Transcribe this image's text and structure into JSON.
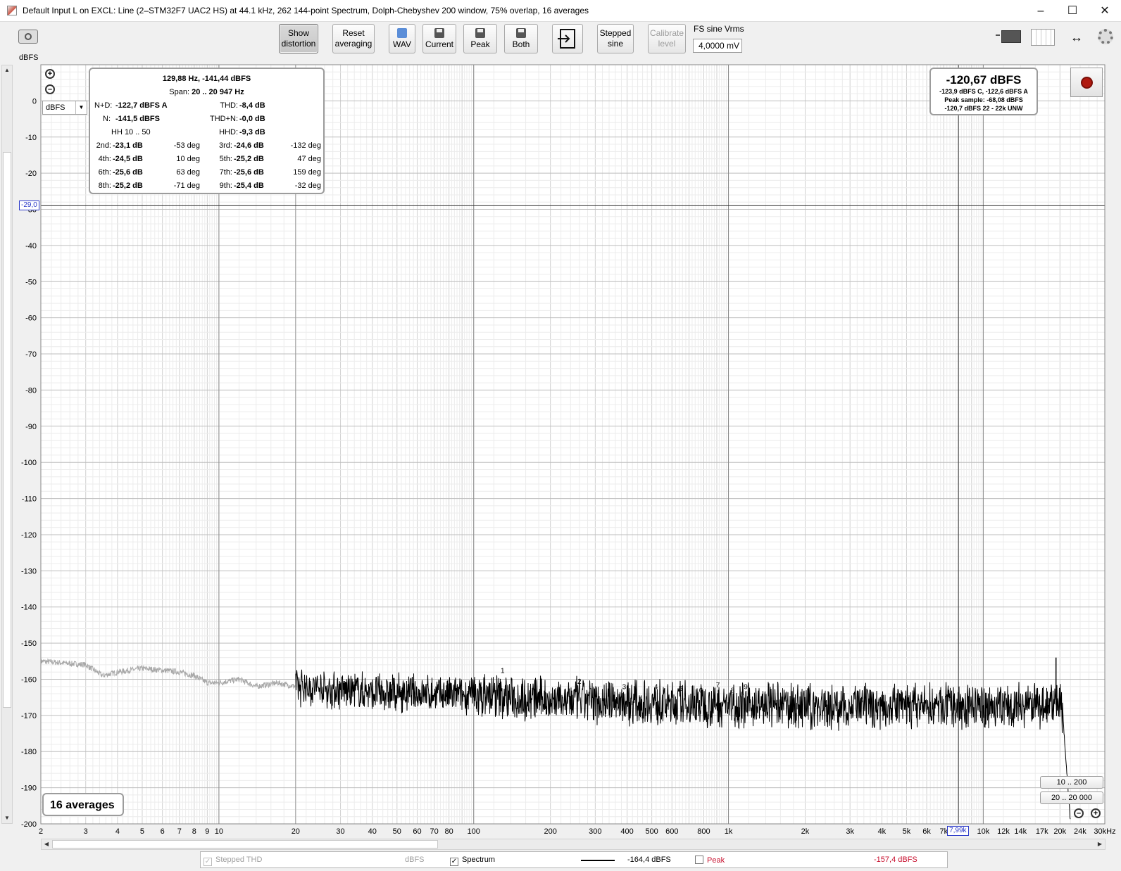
{
  "window": {
    "title": "Default Input L on EXCL: Line (2–STM32F7 UAC2 HS) at 44.1 kHz, 262 144-point Spectrum, Dolph-Chebyshev 200 window, 75% overlap, 16 averages",
    "minimize": "–",
    "maximize": "☐",
    "close": "✕"
  },
  "toolbar": {
    "show_distortion_1": "Show",
    "show_distortion_2": "distortion",
    "reset_averaging_1": "Reset",
    "reset_averaging_2": "averaging",
    "wav": "WAV",
    "current": "Current",
    "peak": "Peak",
    "both": "Both",
    "stepped_sine_1": "Stepped",
    "stepped_sine_2": "sine",
    "calibrate_level_1": "Calibrate",
    "calibrate_level_2": "level",
    "fs_sine_label": "FS sine Vrms",
    "fs_sine_value": "4,0000 mV"
  },
  "plot": {
    "y_unit": "dBFS",
    "unit_select": "dBFS",
    "y_cursor": "-29,0",
    "x_cursor": "7,99k",
    "averages": "16 averages",
    "range_buttons": [
      "10 .. 200",
      "20 .. 20 000"
    ]
  },
  "distortion": {
    "header": "129,88 Hz, -141,44 dBFS",
    "span_label": "Span:",
    "span_value": "20 .. 20 947 Hz",
    "nd_label": "N+D:",
    "nd_value": "-122,7 dBFS A",
    "thd_label": "THD:",
    "thd_value": "-8,4 dB",
    "n_label": "N:",
    "n_value": "-141,5 dBFS",
    "thdn_label": "THD+N:",
    "thdn_value": "-0,0 dB",
    "hh_label": "HH 10 .. 50",
    "hhd_label": "HHD:",
    "hhd_value": "-9,3 dB",
    "harmonics": [
      {
        "label": "2nd:",
        "value": "-23,1 dB",
        "phase": "-53 deg"
      },
      {
        "label": "3rd:",
        "value": "-24,6 dB",
        "phase": "-132 deg"
      },
      {
        "label": "4th:",
        "value": "-24,5 dB",
        "phase": "10 deg"
      },
      {
        "label": "5th:",
        "value": "-25,2 dB",
        "phase": "47 deg"
      },
      {
        "label": "6th:",
        "value": "-25,6 dB",
        "phase": "63 deg"
      },
      {
        "label": "7th:",
        "value": "-25,6 dB",
        "phase": "159 deg"
      },
      {
        "label": "8th:",
        "value": "-25,2 dB",
        "phase": "-71 deg"
      },
      {
        "label": "9th:",
        "value": "-25,4 dB",
        "phase": "-32 deg"
      }
    ]
  },
  "level": {
    "main": "-120,67 dBFS",
    "line1": "-123,9 dBFS C, -122,6 dBFS A",
    "line2": "Peak sample: -68,08 dBFS",
    "line3": "-120,7 dBFS 22 - 22k UNW"
  },
  "legend": {
    "stepped_thd": "Stepped THD",
    "stepped_unit": "dBFS",
    "spectrum": "Spectrum",
    "spectrum_value": "-164,4 dBFS",
    "peak": "Peak",
    "peak_value": "-157,4 dBFS"
  },
  "colors": {
    "trace": "#000000",
    "trace_out_of_span": "#a8a8a8",
    "cursor": "#2a38c8",
    "peak": "#c8102e"
  },
  "chart_data": {
    "type": "line",
    "ylabel": "dBFS",
    "xscale": "log",
    "xlim": [
      2,
      30000
    ],
    "ylim": [
      -200,
      10
    ],
    "yticks": [
      0,
      -10,
      -20,
      -30,
      -40,
      -50,
      -60,
      -70,
      -80,
      -90,
      -100,
      -110,
      -120,
      -130,
      -140,
      -150,
      -160,
      -170,
      -180,
      -190,
      -200
    ],
    "xticks": [
      {
        "v": 2,
        "t": "2"
      },
      {
        "v": 3,
        "t": "3"
      },
      {
        "v": 4,
        "t": "4"
      },
      {
        "v": 5,
        "t": "5"
      },
      {
        "v": 6,
        "t": "6"
      },
      {
        "v": 7,
        "t": "7"
      },
      {
        "v": 8,
        "t": "8"
      },
      {
        "v": 9,
        "t": "9"
      },
      {
        "v": 10,
        "t": "10"
      },
      {
        "v": 20,
        "t": "20"
      },
      {
        "v": 30,
        "t": "30"
      },
      {
        "v": 40,
        "t": "40"
      },
      {
        "v": 50,
        "t": "50"
      },
      {
        "v": 60,
        "t": "60"
      },
      {
        "v": 70,
        "t": "70"
      },
      {
        "v": 80,
        "t": "80"
      },
      {
        "v": 100,
        "t": "100"
      },
      {
        "v": 200,
        "t": "200"
      },
      {
        "v": 300,
        "t": "300"
      },
      {
        "v": 400,
        "t": "400"
      },
      {
        "v": 500,
        "t": "500"
      },
      {
        "v": 600,
        "t": "600"
      },
      {
        "v": 800,
        "t": "800"
      },
      {
        "v": 1000,
        "t": "1k"
      },
      {
        "v": 2000,
        "t": "2k"
      },
      {
        "v": 3000,
        "t": "3k"
      },
      {
        "v": 4000,
        "t": "4k"
      },
      {
        "v": 5000,
        "t": "5k"
      },
      {
        "v": 6000,
        "t": "6k"
      },
      {
        "v": 7000,
        "t": "7k"
      },
      {
        "v": 10000,
        "t": "10k"
      },
      {
        "v": 12000,
        "t": "12k"
      },
      {
        "v": 14000,
        "t": "14k"
      },
      {
        "v": 17000,
        "t": "17k"
      },
      {
        "v": 20000,
        "t": "20k"
      },
      {
        "v": 24000,
        "t": "24k"
      },
      {
        "v": 30000,
        "t": "30kHz"
      }
    ],
    "span": [
      20,
      20947
    ],
    "cursor": {
      "x": 7990,
      "y": -29.0
    },
    "series": [
      {
        "points": [
          [
            2,
            -155
          ],
          [
            3,
            -156
          ],
          [
            3.5,
            -159
          ],
          [
            4,
            -158
          ],
          [
            5,
            -157
          ],
          [
            6,
            -157.5
          ],
          [
            7,
            -158
          ],
          [
            8,
            -159
          ],
          [
            9,
            -161
          ],
          [
            10,
            -161
          ],
          [
            12,
            -160
          ],
          [
            14,
            -162
          ],
          [
            17,
            -161
          ],
          [
            20,
            -162
          ],
          [
            30,
            -163
          ],
          [
            50,
            -164
          ],
          [
            100,
            -164.5
          ],
          [
            200,
            -165.5
          ],
          [
            500,
            -166.5
          ],
          [
            1000,
            -167
          ],
          [
            2000,
            -167.5
          ],
          [
            5000,
            -167.5
          ],
          [
            10000,
            -167.5
          ],
          [
            18000,
            -167
          ],
          [
            20000,
            -166
          ],
          [
            20500,
            -169
          ],
          [
            21000,
            -180
          ],
          [
            22000,
            -200
          ]
        ],
        "peak": {
          "x": 19300,
          "y": -154
        }
      }
    ],
    "harmonic_markers": [
      {
        "n": "1",
        "x": 129.88,
        "y": -159
      },
      {
        "n": "2",
        "x": 259.8,
        "y": -162
      },
      {
        "n": "3",
        "x": 389.6,
        "y": -163.5
      },
      {
        "n": "4",
        "x": 519.5,
        "y": -163.5
      },
      {
        "n": "5",
        "x": 649.4,
        "y": -164
      },
      {
        "n": "6",
        "x": 779.3,
        "y": -164.5
      },
      {
        "n": "7",
        "x": 909.2,
        "y": -163
      },
      {
        "n": "8",
        "x": 1039,
        "y": -164.5
      },
      {
        "n": "9",
        "x": 1168.9,
        "y": -163.5
      }
    ]
  }
}
